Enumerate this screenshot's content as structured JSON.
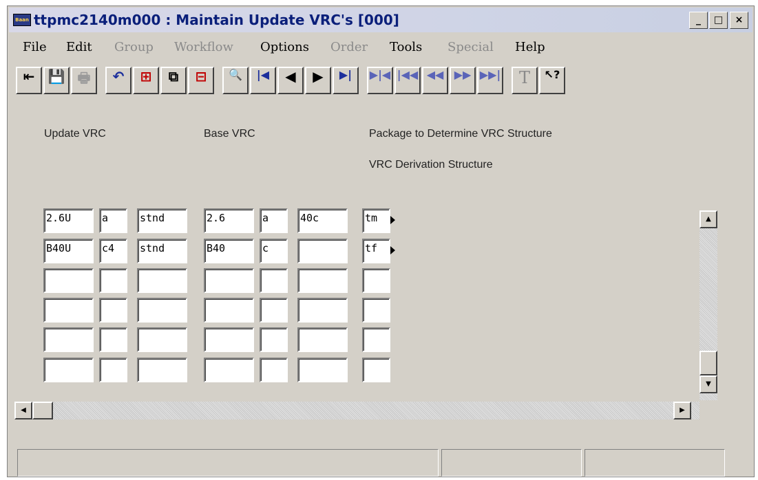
{
  "window": {
    "title": "ttpmc2140m000 : Maintain Update VRC's [000]",
    "app_icon_text": "Baan",
    "controls": {
      "minimize": "_",
      "maximize": "□",
      "close": "×"
    }
  },
  "menu": [
    {
      "label": "File",
      "enabled": true
    },
    {
      "label": "Edit",
      "enabled": true
    },
    {
      "label": "Group",
      "enabled": false
    },
    {
      "label": "Workflow",
      "enabled": false
    },
    {
      "label": "Options",
      "enabled": true
    },
    {
      "label": "Order",
      "enabled": false
    },
    {
      "label": "Tools",
      "enabled": true
    },
    {
      "label": "Special",
      "enabled": false
    },
    {
      "label": "Help",
      "enabled": true
    }
  ],
  "toolbar": [
    {
      "name": "exit-icon",
      "glyph": "⇤",
      "enabled": true
    },
    {
      "name": "save-icon",
      "glyph": "💾",
      "enabled": true
    },
    {
      "name": "print-icon",
      "glyph": "🖶",
      "enabled": false
    },
    {
      "name": "undo-icon",
      "glyph": "↶",
      "enabled": true
    },
    {
      "name": "insert-record-icon",
      "glyph": "⊞",
      "enabled": true
    },
    {
      "name": "duplicate-record-icon",
      "glyph": "⧉",
      "enabled": true
    },
    {
      "name": "delete-record-icon",
      "glyph": "⊟",
      "enabled": true
    },
    {
      "name": "find-icon",
      "glyph": "🔍",
      "enabled": true
    },
    {
      "name": "first-record-icon",
      "glyph": "|◀",
      "enabled": true
    },
    {
      "name": "previous-record-icon",
      "glyph": "◀",
      "enabled": true
    },
    {
      "name": "next-record-icon",
      "glyph": "▶",
      "enabled": true
    },
    {
      "name": "last-record-icon",
      "glyph": "▶|",
      "enabled": true
    },
    {
      "name": "group-icon",
      "glyph": "▶|◀",
      "enabled": false
    },
    {
      "name": "first-group-icon",
      "glyph": "|◀◀",
      "enabled": false
    },
    {
      "name": "previous-group-icon",
      "glyph": "◀◀",
      "enabled": false
    },
    {
      "name": "next-group-icon",
      "glyph": "▶▶",
      "enabled": false
    },
    {
      "name": "last-group-icon",
      "glyph": "▶▶|",
      "enabled": false
    },
    {
      "name": "text-icon",
      "glyph": "T",
      "enabled": false
    },
    {
      "name": "help-pointer-icon",
      "glyph": "↖?",
      "enabled": true
    }
  ],
  "labels": {
    "update_vrc": "Update VRC",
    "base_vrc": "Base VRC",
    "package": "Package to Determine VRC Structure",
    "derivation": "VRC Derivation Structure"
  },
  "rows": [
    [
      "2.6U",
      "a",
      "stnd",
      "2.6",
      "a",
      "40c",
      "tm"
    ],
    [
      "B40U",
      "c4",
      "stnd",
      "B40",
      "c",
      "",
      "tf"
    ],
    [
      "",
      "",
      "",
      "",
      "",
      "",
      ""
    ],
    [
      "",
      "",
      "",
      "",
      "",
      "",
      ""
    ],
    [
      "",
      "",
      "",
      "",
      "",
      "",
      ""
    ],
    [
      "",
      "",
      "",
      "",
      "",
      "",
      ""
    ]
  ],
  "scroll": {
    "up": "▲",
    "down": "▼",
    "left": "◀",
    "right": "▶"
  },
  "status": [
    "",
    "",
    ""
  ],
  "colors": {
    "face": "#d4d0c8",
    "title_text": "#0a1f7a",
    "nav_blue": "#1c2f9c",
    "record_red": "#c00000"
  }
}
